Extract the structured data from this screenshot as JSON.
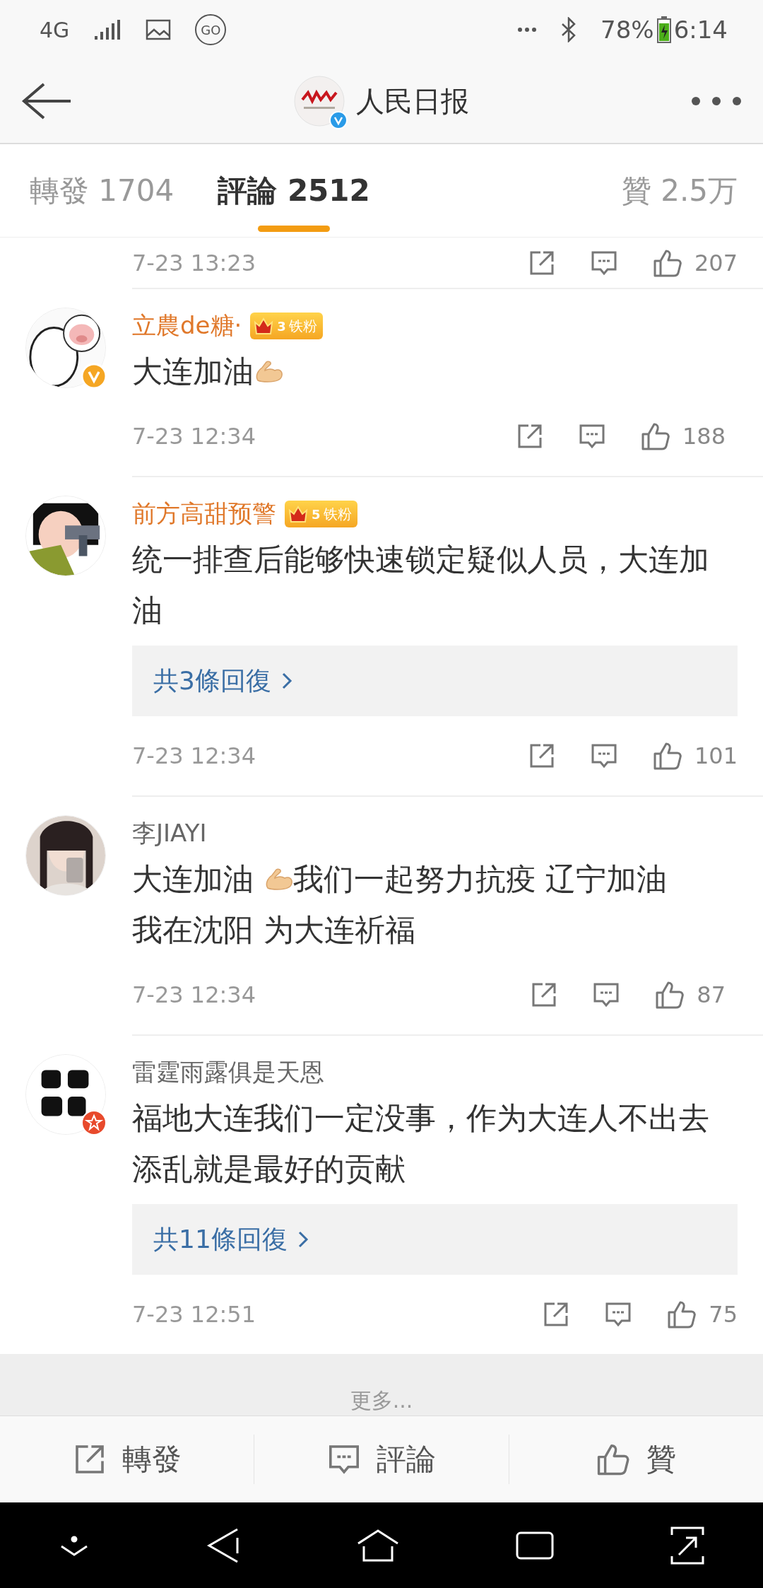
{
  "status_bar": {
    "network": "4G",
    "go": "GO",
    "battery": "78%",
    "time": "6:14"
  },
  "header": {
    "title": "人民日报"
  },
  "tabs": [
    {
      "label": "轉發",
      "count": "1704",
      "selected": false
    },
    {
      "label": "評論",
      "count": "2512",
      "selected": true
    }
  ],
  "likes_tab": {
    "label": "贊",
    "count": "2.5万"
  },
  "top_row": {
    "date": "7-23 13:23",
    "likes": "207"
  },
  "comments": [
    {
      "kind": "verified",
      "name": "立農de糖·",
      "vip": true,
      "fan": {
        "level": "3",
        "label": "铁粉"
      },
      "segments": [
        {
          "kind": "text",
          "text": "大连加油"
        },
        {
          "kind": "emoji"
        }
      ],
      "date": "7-23 12:34",
      "likes": "188"
    },
    {
      "kind": "plain",
      "name": "前方高甜预警",
      "vip": true,
      "fan": {
        "level": "5",
        "label": "铁粉"
      },
      "segments": [
        {
          "kind": "text",
          "text": "统一排查后能够快速锁定疑似人员，大连加油"
        }
      ],
      "replies": "共3條回復",
      "date": "7-23 12:34",
      "likes": "101"
    },
    {
      "kind": "plain",
      "name": "李JIAYI",
      "vip": false,
      "segments": [
        {
          "kind": "text",
          "text": "大连加油 "
        },
        {
          "kind": "emoji"
        },
        {
          "kind": "text",
          "text": "我们一起努力抗疫 辽宁加油"
        },
        {
          "kind": "break"
        },
        {
          "kind": "text",
          "text": "我在沈阳 为大连祈福"
        }
      ],
      "date": "7-23 12:34",
      "likes": "87"
    },
    {
      "kind": "star",
      "name": "雷霆雨露俱是天恩",
      "vip": false,
      "segments": [
        {
          "kind": "text",
          "text": "福地大连我们一定没事，作为大连人不出去添乱就是最好的贡献"
        }
      ],
      "replies": "共11條回復",
      "date": "7-23 12:51",
      "likes": "75"
    }
  ],
  "more": "更多...",
  "actions": [
    {
      "kind": "share",
      "label": "轉發"
    },
    {
      "kind": "comment",
      "label": "評論"
    },
    {
      "kind": "like",
      "label": "贊"
    }
  ]
}
